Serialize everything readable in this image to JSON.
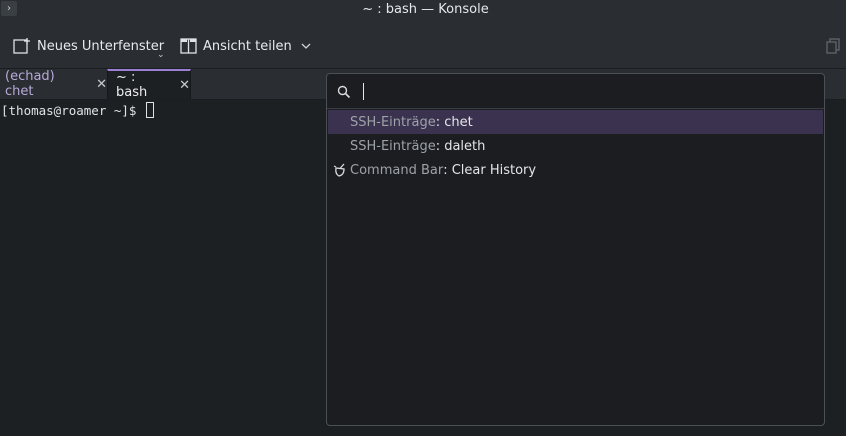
{
  "window": {
    "title": "~ : bash — Konsole",
    "menu_glyph": "›"
  },
  "toolbar": {
    "new_tab_label": "Neues Unterfenster",
    "split_view_label": "Ansicht teilen"
  },
  "tabs": [
    {
      "label": "(echad) chet"
    },
    {
      "label": "~ : bash"
    }
  ],
  "terminal": {
    "prompt": "[thomas@roamer ~]$ "
  },
  "command_bar": {
    "search_value": "",
    "items": [
      {
        "category": "SSH-Einträge",
        "separator": ": ",
        "name": "chet",
        "selected": true
      },
      {
        "category": "SSH-Einträge",
        "separator": ": ",
        "name": "daleth",
        "selected": false
      },
      {
        "category": "Command Bar",
        "separator": ": ",
        "name": "Clear History",
        "selected": false,
        "icon": "broom-icon"
      }
    ]
  },
  "colors": {
    "accent": "#9b7fd4",
    "selection": "#3b3250",
    "background": "#232629",
    "terminal_bg": "#1d2023"
  }
}
